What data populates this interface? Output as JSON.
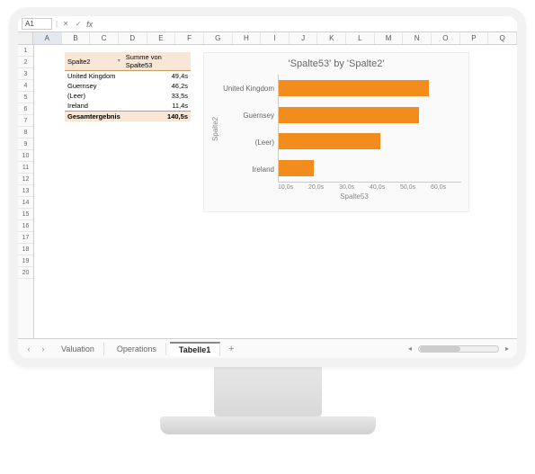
{
  "formula_bar": {
    "cell_ref": "A1",
    "fx_label": "fx",
    "value": ""
  },
  "columns": [
    "A",
    "B",
    "C",
    "D",
    "E",
    "F",
    "G",
    "H",
    "I",
    "J",
    "K",
    "L",
    "M",
    "N",
    "O",
    "P",
    "Q"
  ],
  "rows": [
    "1",
    "2",
    "3",
    "4",
    "5",
    "6",
    "7",
    "8",
    "9",
    "10",
    "11",
    "12",
    "13",
    "14",
    "15",
    "16",
    "17",
    "18",
    "19",
    "20"
  ],
  "pivot": {
    "header_field": "Spalte2",
    "header_value": "Summe von Spalte53",
    "rows": [
      {
        "label": "United Kingdom",
        "value": "49,4s"
      },
      {
        "label": "Guernsey",
        "value": "46,2s"
      },
      {
        "label": "(Leer)",
        "value": "33,5s"
      },
      {
        "label": "Ireland",
        "value": "11,4s"
      }
    ],
    "total_label": "Gesamtergebnis",
    "total_value": "140,5s"
  },
  "chart_data": {
    "type": "bar",
    "orientation": "horizontal",
    "title": "'Spalte53' by 'Spalte2'",
    "ylabel": "Spalte2",
    "xlabel": "Spalte53",
    "categories": [
      "United Kingdom",
      "Guernsey",
      "(Leer)",
      "Ireland"
    ],
    "values": [
      49.4,
      46.2,
      33.5,
      11.4
    ],
    "xticks": [
      "10,0s",
      "20,0s",
      "30,0s",
      "40,0s",
      "50,0s",
      "60,0s"
    ],
    "xlim": [
      0,
      60
    ],
    "bar_color": "#f28c1c"
  },
  "sheets": {
    "tabs": [
      "Valuation",
      "Operations",
      "Tabelle1"
    ],
    "active_index": 2,
    "add_label": "+"
  }
}
